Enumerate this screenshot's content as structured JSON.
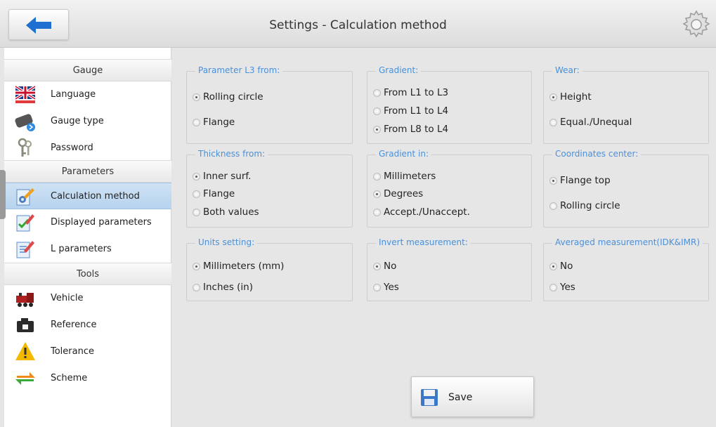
{
  "header": {
    "title": "Settings - Calculation method"
  },
  "sidebar": {
    "sections": [
      {
        "title": "Gauge",
        "items": [
          {
            "label": "Language",
            "icon": "uk-flag-icon"
          },
          {
            "label": "Gauge type",
            "icon": "gauge-device-icon"
          },
          {
            "label": "Password",
            "icon": "keys-icon"
          }
        ]
      },
      {
        "title": "Parameters",
        "items": [
          {
            "label": "Calculation method",
            "icon": "gear-pencil-icon",
            "selected": true
          },
          {
            "label": "Displayed parameters",
            "icon": "checklist-icon"
          },
          {
            "label": "L parameters",
            "icon": "edit-list-icon"
          }
        ]
      },
      {
        "title": "Tools",
        "items": [
          {
            "label": "Vehicle",
            "icon": "locomotive-icon"
          },
          {
            "label": "Reference",
            "icon": "camera-icon"
          },
          {
            "label": "Tolerance",
            "icon": "warning-icon"
          },
          {
            "label": "Scheme",
            "icon": "swap-arrows-icon"
          }
        ]
      }
    ]
  },
  "groups": {
    "param_l3": {
      "title": "Parameter L3 from:",
      "options": [
        "Rolling circle",
        "Flange"
      ],
      "selected": 0
    },
    "gradient": {
      "title": "Gradient:",
      "options": [
        "From L1 to L3",
        "From L1 to L4",
        "From L8 to L4"
      ],
      "selected": 2
    },
    "wear": {
      "title": "Wear:",
      "options": [
        "Height",
        "Equal./Unequal"
      ],
      "selected": 0
    },
    "thickness": {
      "title": "Thickness from:",
      "options": [
        "Inner surf.",
        "Flange",
        "Both values"
      ],
      "selected": 0
    },
    "gradient_in": {
      "title": "Gradient in:",
      "options": [
        "Millimeters",
        "Degrees",
        "Accept./Unaccept."
      ],
      "selected": 1
    },
    "coordinates": {
      "title": "Coordinates center:",
      "options": [
        "Flange top",
        "Rolling circle"
      ],
      "selected": 0
    },
    "units": {
      "title": "Units setting:",
      "options": [
        "Millimeters (mm)",
        "Inches (in)"
      ],
      "selected": 0
    },
    "invert": {
      "title": "Invert measurement:",
      "options": [
        "No",
        "Yes"
      ],
      "selected": 0
    },
    "averaged": {
      "title": "Averaged measurement(IDK&IMR)",
      "options": [
        "No",
        "Yes"
      ],
      "selected": 0
    }
  },
  "save_button": {
    "label": "Save"
  },
  "colors": {
    "accent": "#4a90d9",
    "selected_bg": "#b7d3ee",
    "back_arrow": "#1e6fd0"
  }
}
